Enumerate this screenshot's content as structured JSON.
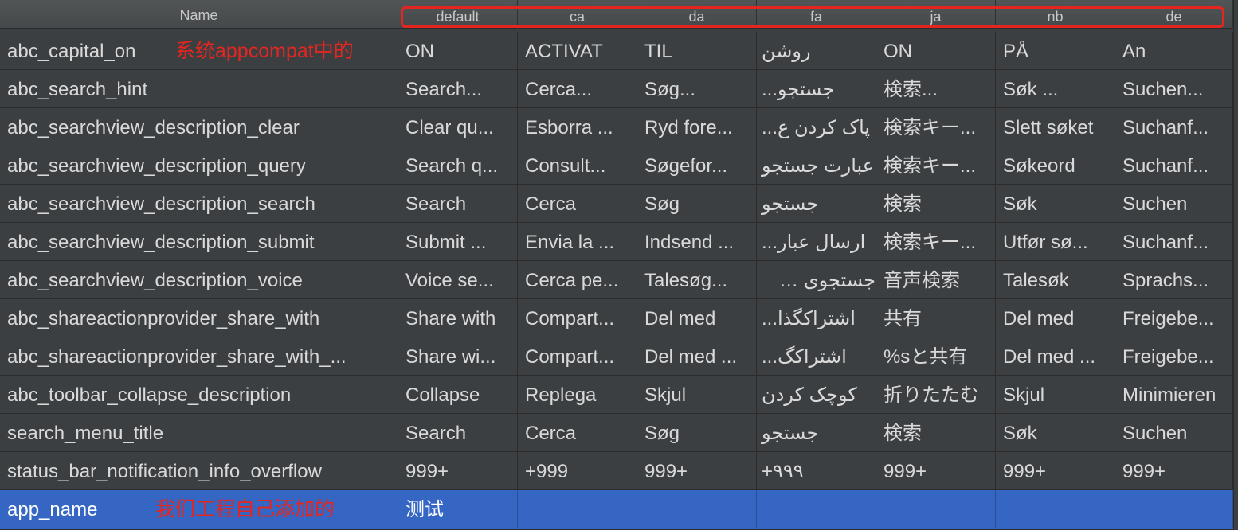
{
  "header": {
    "name_label": "Name",
    "locales": [
      "default",
      "ca",
      "da",
      "fa",
      "ja",
      "nb",
      "de"
    ]
  },
  "annotations": {
    "system_note": "系统appcompat中的",
    "project_note": "我们工程自己添加的",
    "color": "#e3261f"
  },
  "colors": {
    "background": "#3c3f41",
    "selected_row": "#3566c4",
    "text": "#d9d9d9"
  },
  "rows": [
    {
      "key": "abc_capital_on",
      "values": [
        "ON",
        "ACTIVAT",
        "TIL",
        "روشن",
        "ON",
        "PÅ",
        "An"
      ]
    },
    {
      "key": "abc_search_hint",
      "values": [
        "Search...",
        "Cerca...",
        "Søg...",
        "جستجو...",
        "検索...",
        "Søk ...",
        "Suchen..."
      ]
    },
    {
      "key": "abc_searchview_description_clear",
      "values": [
        "Clear qu...",
        "Esborra ...",
        "Ryd fore...",
        "پاک کردن ع...",
        "検索キー...",
        "Slett søket",
        "Suchanf..."
      ]
    },
    {
      "key": "abc_searchview_description_query",
      "values": [
        "Search q...",
        "Consult...",
        "Søgefor...",
        "عبارت جستجو",
        "検索キー...",
        "Søkeord",
        "Suchanf..."
      ]
    },
    {
      "key": "abc_searchview_description_search",
      "values": [
        "Search",
        "Cerca",
        "Søg",
        "جستجو",
        "検索",
        "Søk",
        "Suchen"
      ]
    },
    {
      "key": "abc_searchview_description_submit",
      "values": [
        "Submit ...",
        "Envia la ...",
        "Indsend ...",
        "ارسال عبار...",
        "検索キー...",
        "Utfør sø...",
        "Suchanf..."
      ]
    },
    {
      "key": "abc_searchview_description_voice",
      "values": [
        "Voice se...",
        "Cerca pe...",
        "Talesøg...",
        "جستجوی ش...",
        "音声検索",
        "Talesøk",
        "Sprachs..."
      ]
    },
    {
      "key": "abc_shareactionprovider_share_with",
      "values": [
        "Share with",
        "Compart...",
        "Del med",
        "اشتراکگذا...",
        "共有",
        "Del med",
        "Freigebe..."
      ]
    },
    {
      "key": "abc_shareactionprovider_share_with_...",
      "values": [
        "Share wi...",
        "Compart...",
        "Del med ...",
        "اشتراکگ...",
        "%sと共有",
        "Del med ...",
        "Freigebe..."
      ]
    },
    {
      "key": "abc_toolbar_collapse_description",
      "values": [
        "Collapse",
        "Replega",
        "Skjul",
        "کوچک کردن",
        "折りたたむ",
        "Skjul",
        "Minimieren"
      ]
    },
    {
      "key": "search_menu_title",
      "values": [
        "Search",
        "Cerca",
        "Søg",
        "جستجو",
        "検索",
        "Søk",
        "Suchen"
      ]
    },
    {
      "key": "status_bar_notification_info_overflow",
      "values": [
        "999+",
        "+999",
        "999+",
        "۹۹۹+",
        "999+",
        "999+",
        "999+"
      ]
    },
    {
      "key": "app_name",
      "values": [
        "测试",
        "",
        "",
        "",
        "",
        "",
        ""
      ]
    }
  ]
}
